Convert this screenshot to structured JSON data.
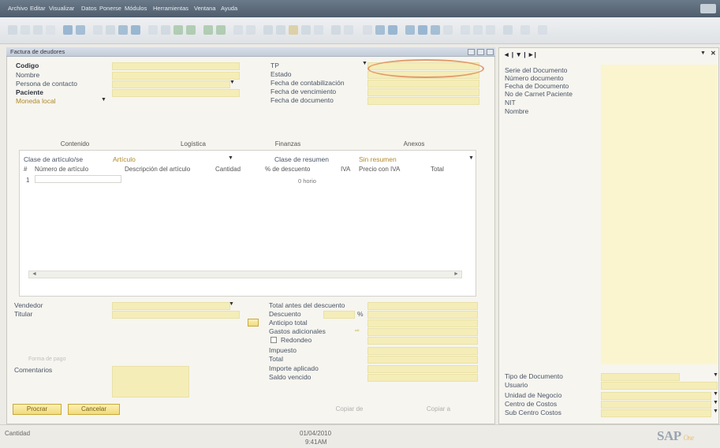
{
  "menu": {
    "items": [
      "Archivo",
      "Editar",
      "Visualizar",
      "Datos",
      "Ponerse",
      "Módulos",
      "Herramientas",
      "Ventana",
      "Ayuda"
    ]
  },
  "window": {
    "title": "Factura de deudores"
  },
  "header_left": {
    "codigo": "Codigo",
    "nombre": "Nombre",
    "persona_contacto": "Persona de contacto",
    "paciente": "Paciente",
    "moneda": "Moneda local"
  },
  "header_right": {
    "tp": "TP",
    "estado": "Estado",
    "fecha_contabilizacion": "Fecha de contabilización",
    "fecha_vencimiento": "Fecha de vencimiento",
    "fecha_documento": "Fecha de documento"
  },
  "tabs": [
    "Contenido",
    "Logística",
    "Finanzas",
    "Anexos"
  ],
  "content": {
    "clase_articulo_label": "Clase de artículo/se",
    "clase_articulo_value": "Artículo",
    "clase_resumen_label": "Clase de resumen",
    "clase_resumen_value": "Sin resumen",
    "columns": [
      "#",
      "Número de artículo",
      "Descripción del artículo",
      "Cantidad",
      "% de descuento",
      "IVA",
      "Precio con IVA",
      "Total"
    ],
    "row1_num": "1",
    "row1_desc": "0 horio"
  },
  "footer_left": {
    "vendedor": "Vendedor",
    "titular": "Titular",
    "forma_pago": "Forma de pago",
    "comentarios": "Comentarios"
  },
  "totals": {
    "total_antes": "Total antes del descuento",
    "descuento": "Descuento",
    "descuento_pct": "%",
    "anticipo": "Anticipo total",
    "gastos": "Gastos adicionales",
    "redondeo": "Redondeo",
    "impuesto": "Impuesto",
    "total": "Total",
    "importe_aplicado": "Importe aplicado",
    "saldo_vencido": "Saldo vencido"
  },
  "buttons": {
    "primary": "Procrar",
    "cancel": "Cancelar",
    "copiar_de": "Copiar de",
    "copiar_a": "Copiar a"
  },
  "right_panel": {
    "nav": "◄ | ▼ | ►|",
    "serie": "Serie del Documento",
    "numero": "Número documento",
    "fecha": "Fecha de Documento",
    "carnet": "No de Carnet Paciente",
    "nit": "NIT",
    "nombre": "Nombre",
    "tipo_doc": "Tipo de Documento",
    "usuario": "Usuario",
    "unidad": "Unidad de Negocio",
    "centro": "Centro de Costos",
    "subcentro": "Sub Centro Costos"
  },
  "status": {
    "left": "Cantidad",
    "date": "01/04/2010",
    "time": "9:41AM",
    "logo": "SAP",
    "logo_sub": "One"
  },
  "colors": {
    "field_yellow": "#f5edb8",
    "button_gold": "#f2db7a",
    "highlight_oval": "#e39a6a",
    "menu_bar": "#5a6878"
  }
}
